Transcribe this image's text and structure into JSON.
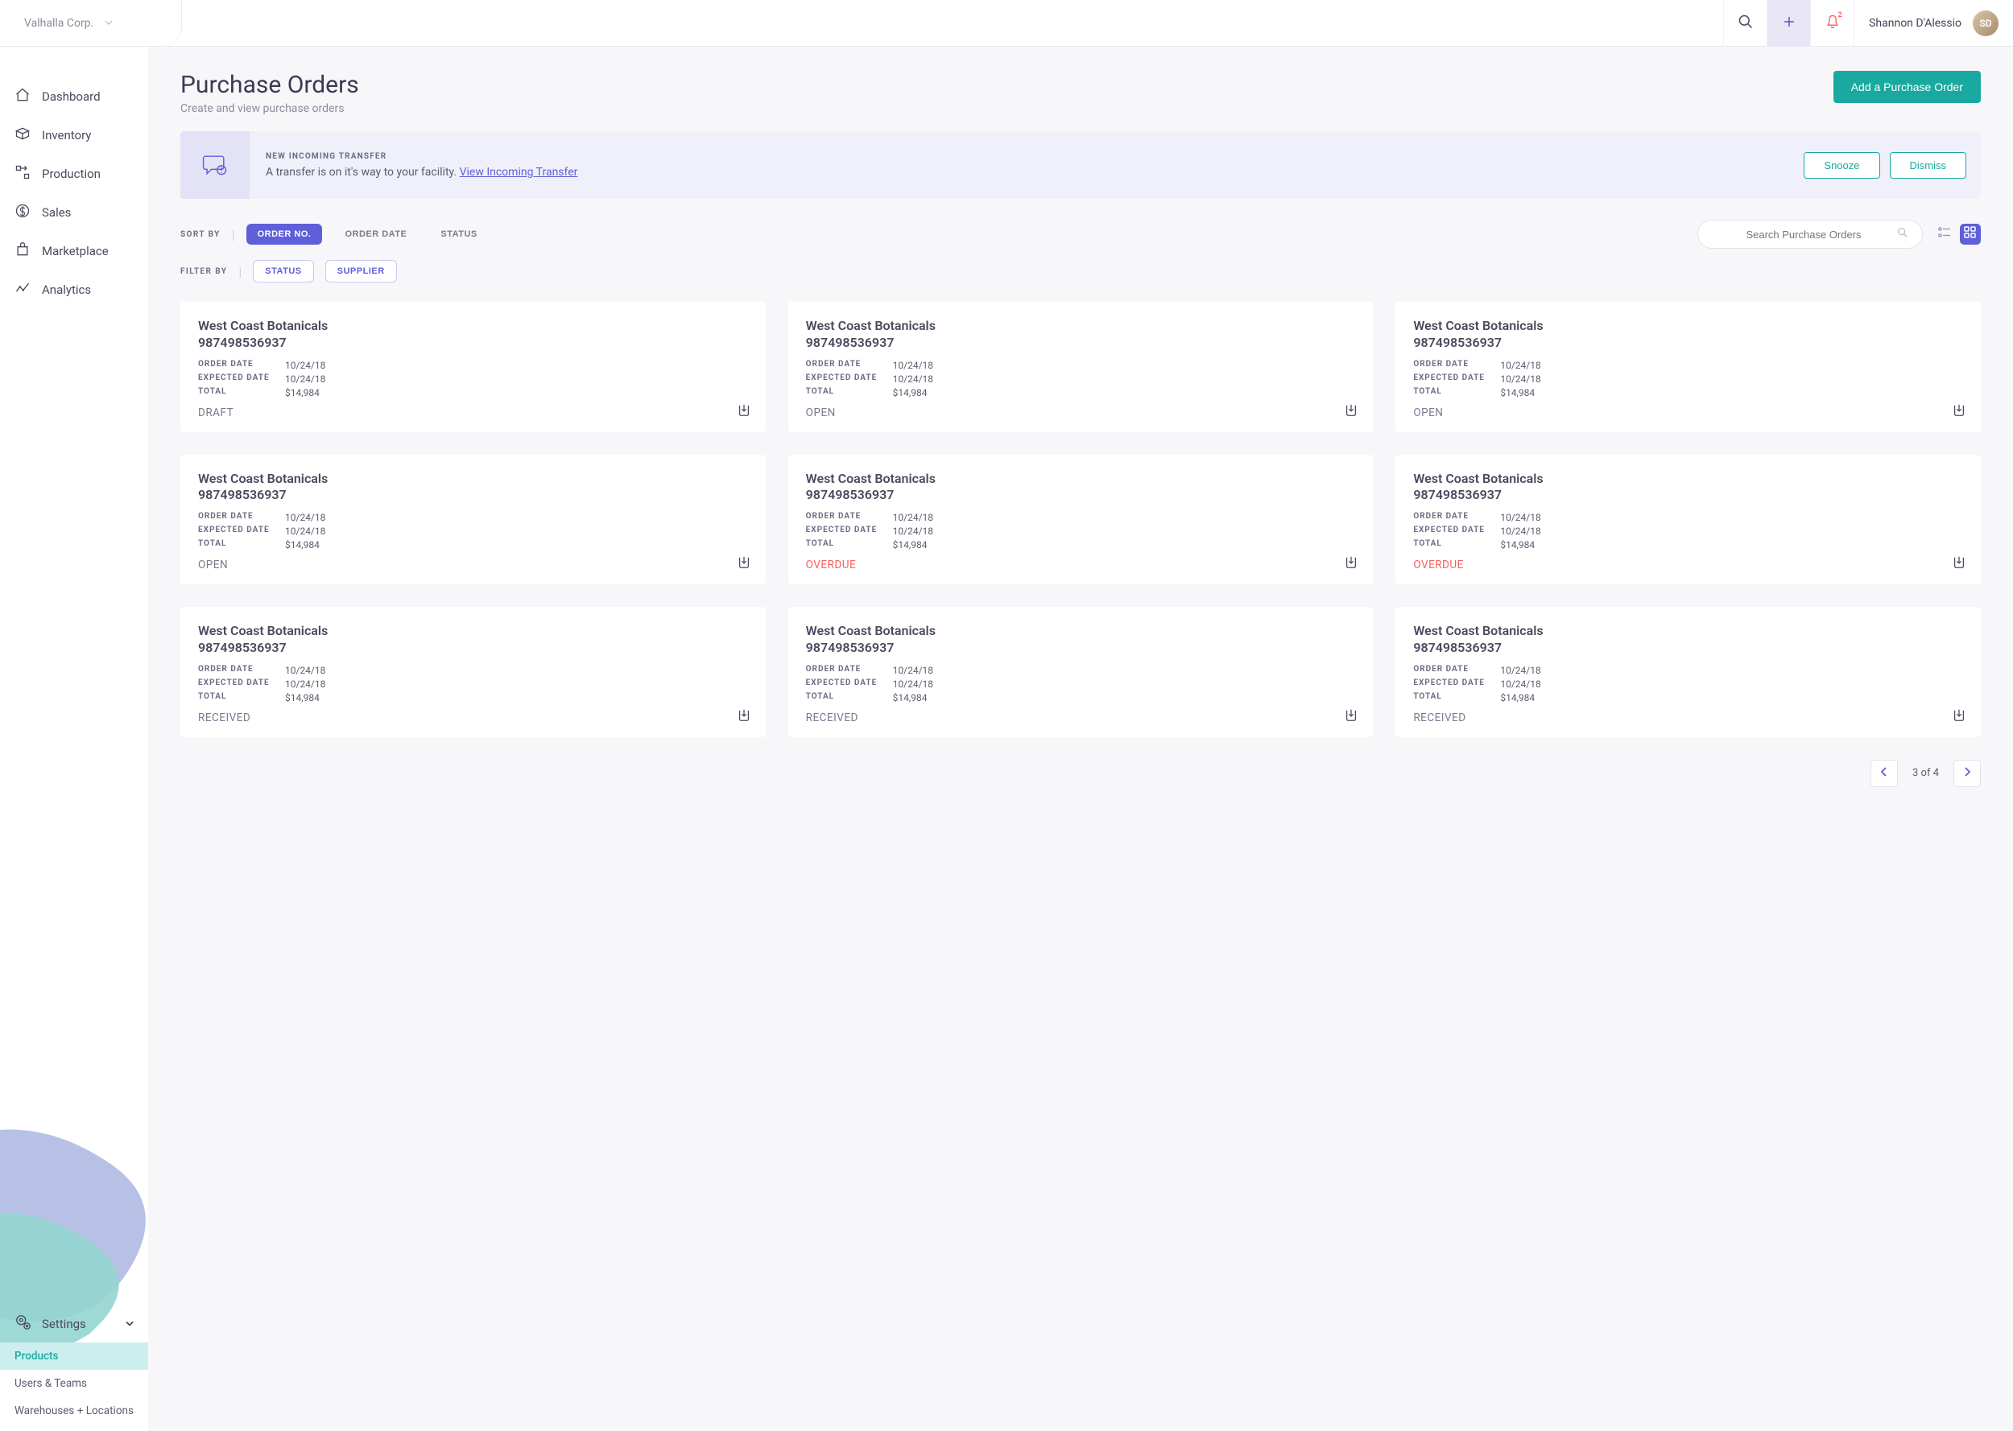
{
  "org": {
    "name": "Valhalla Corp."
  },
  "user": {
    "name": "Shannon D'Alessio"
  },
  "notification_badge": "2",
  "sidebar": {
    "items": [
      {
        "label": "Dashboard"
      },
      {
        "label": "Inventory"
      },
      {
        "label": "Production"
      },
      {
        "label": "Sales"
      },
      {
        "label": "Marketplace"
      },
      {
        "label": "Analytics"
      }
    ],
    "settings_label": "Settings",
    "sub_items": [
      {
        "label": "Products",
        "active": true
      },
      {
        "label": "Users & Teams"
      },
      {
        "label": "Warehouses + Locations"
      }
    ]
  },
  "page": {
    "title": "Purchase Orders",
    "subtitle": "Create and view purchase orders",
    "primary_action": "Add a Purchase Order"
  },
  "banner": {
    "title": "NEW INCOMING TRANSFER",
    "message": "A transfer is on it's way to your facility. ",
    "link_text": "View Incoming Transfer",
    "snooze": "Snooze",
    "dismiss": "Dismiss"
  },
  "toolbar": {
    "sort_label": "SORT BY",
    "sort_options": [
      "ORDER NO.",
      "ORDER DATE",
      "STATUS"
    ],
    "filter_label": "FILTER BY",
    "filter_options": [
      "STATUS",
      "SUPPLIER"
    ],
    "search_placeholder": "Search Purchase Orders"
  },
  "card_labels": {
    "order_date": "ORDER DATE",
    "expected_date": "EXPECTED DATE",
    "total": "TOTAL"
  },
  "orders": [
    {
      "supplier": "West Coast Botanicals",
      "number": "987498536937",
      "order_date": "10/24/18",
      "expected_date": "10/24/18",
      "total": "$14,984",
      "status": "DRAFT",
      "status_class": "draft"
    },
    {
      "supplier": "West Coast Botanicals",
      "number": "987498536937",
      "order_date": "10/24/18",
      "expected_date": "10/24/18",
      "total": "$14,984",
      "status": "OPEN",
      "status_class": "open"
    },
    {
      "supplier": "West Coast Botanicals",
      "number": "987498536937",
      "order_date": "10/24/18",
      "expected_date": "10/24/18",
      "total": "$14,984",
      "status": "OPEN",
      "status_class": "open"
    },
    {
      "supplier": "West Coast Botanicals",
      "number": "987498536937",
      "order_date": "10/24/18",
      "expected_date": "10/24/18",
      "total": "$14,984",
      "status": "OPEN",
      "status_class": "open"
    },
    {
      "supplier": "West Coast Botanicals",
      "number": "987498536937",
      "order_date": "10/24/18",
      "expected_date": "10/24/18",
      "total": "$14,984",
      "status": "OVERDUE",
      "status_class": "overdue"
    },
    {
      "supplier": "West Coast Botanicals",
      "number": "987498536937",
      "order_date": "10/24/18",
      "expected_date": "10/24/18",
      "total": "$14,984",
      "status": "OVERDUE",
      "status_class": "overdue"
    },
    {
      "supplier": "West Coast Botanicals",
      "number": "987498536937",
      "order_date": "10/24/18",
      "expected_date": "10/24/18",
      "total": "$14,984",
      "status": "RECEIVED",
      "status_class": "received"
    },
    {
      "supplier": "West Coast Botanicals",
      "number": "987498536937",
      "order_date": "10/24/18",
      "expected_date": "10/24/18",
      "total": "$14,984",
      "status": "RECEIVED",
      "status_class": "received"
    },
    {
      "supplier": "West Coast Botanicals",
      "number": "987498536937",
      "order_date": "10/24/18",
      "expected_date": "10/24/18",
      "total": "$14,984",
      "status": "RECEIVED",
      "status_class": "received"
    }
  ],
  "pagination": {
    "text": "3 of 4"
  }
}
